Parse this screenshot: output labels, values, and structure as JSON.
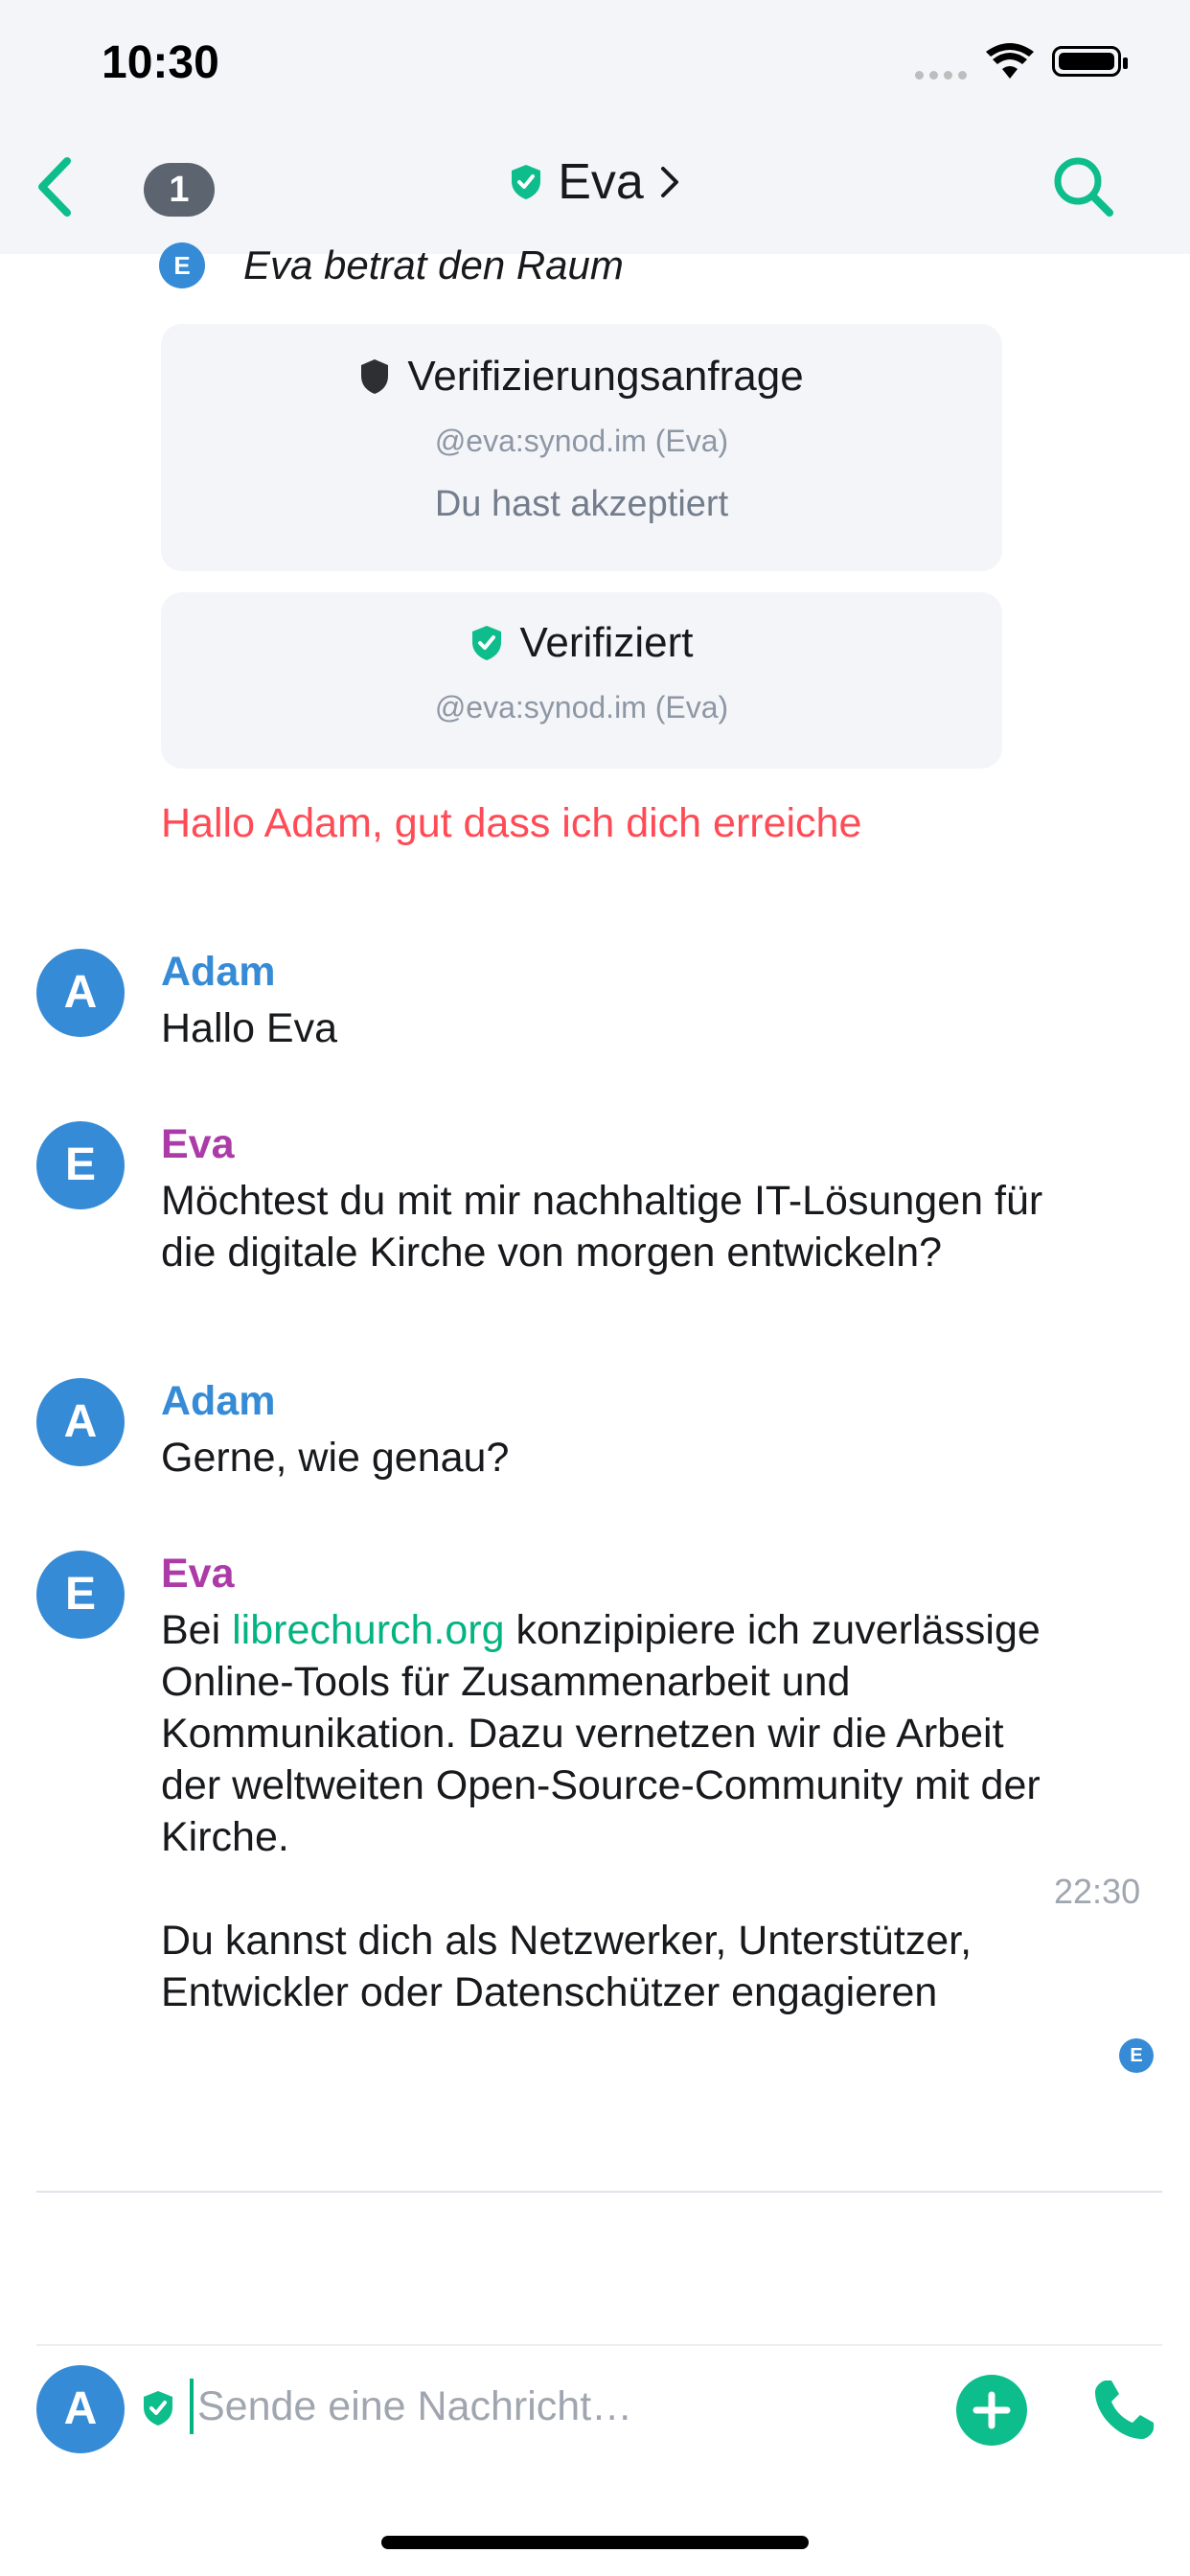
{
  "status_bar": {
    "time": "10:30"
  },
  "nav": {
    "unread_count": "1",
    "room_name": "Eva",
    "icons": [
      "back-chevron-icon",
      "shield-check-icon",
      "chevron-right-icon",
      "search-icon"
    ]
  },
  "timeline": {
    "join_event": {
      "avatar_letter": "E",
      "text": "Eva betrat den Raum"
    },
    "verification_request": {
      "title": "Verifizierungsanfrage",
      "user": "@eva:synod.im (Eva)",
      "status": "Du hast akzeptiert"
    },
    "verified": {
      "title": "Verifiziert",
      "user": "@eva:synod.im (Eva)"
    },
    "error_message": "Hallo Adam, gut dass ich dich erreiche",
    "messages": [
      {
        "avatar": "A",
        "sender": "Adam",
        "lines": [
          "Hallo Eva"
        ]
      },
      {
        "avatar": "E",
        "sender": "Eva",
        "lines": [
          "Möchtest du mit mir nachhaltige IT-Lösungen für",
          "die digitale Kirche von morgen entwickeln?"
        ]
      },
      {
        "avatar": "A",
        "sender": "Adam",
        "lines": [
          "Gerne, wie genau?"
        ]
      },
      {
        "avatar": "E",
        "sender": "Eva",
        "first_prefix": "Bei ",
        "link": "librechurch.org",
        "first_suffix": " konzipipiere ich zuverlässige",
        "lines": [
          "Online-Tools für Zusammenarbeit und",
          "Kommunikation. Dazu vernetzen wir die Arbeit",
          "der weltweiten Open-Source-Community mit der",
          "Kirche."
        ],
        "timestamp": "22:30",
        "second_lines": [
          "Du kannst dich als Netzwerker, Unterstützer,",
          "Entwickler oder Datenschützer engagieren"
        ],
        "read_receipt": "E"
      }
    ]
  },
  "composer": {
    "avatar": "A",
    "placeholder": "Sende eine Nachricht…",
    "value": ""
  },
  "colors": {
    "accent": "#0dbd8b",
    "adam": "#368bd6",
    "eva": "#ac3ba8",
    "error": "#ff4b55",
    "header_bg": "#f4f5f9"
  }
}
